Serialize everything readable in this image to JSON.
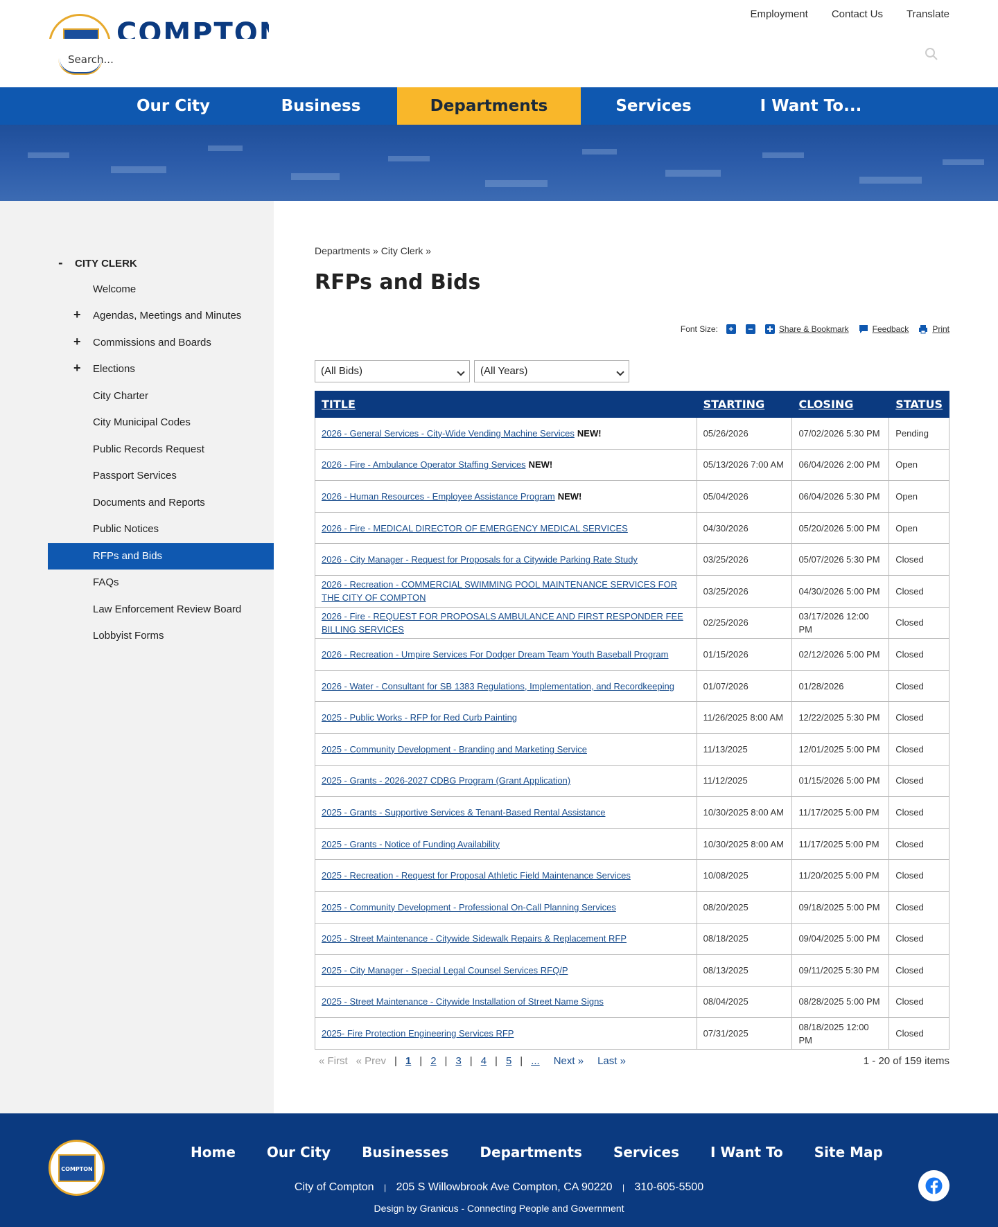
{
  "header": {
    "logo_text": "COMPTON",
    "search_placeholder": "Search...",
    "top_links": [
      "Employment",
      "Contact Us",
      "Translate"
    ]
  },
  "nav": {
    "items": [
      "Our City",
      "Business",
      "Departments",
      "Services",
      "I Want To..."
    ],
    "active": "Departments"
  },
  "sidebar": {
    "group_label": "CITY CLERK",
    "items": [
      {
        "label": "Welcome",
        "expandable": false
      },
      {
        "label": "Agendas, Meetings and Minutes",
        "expandable": true
      },
      {
        "label": "Commissions and Boards",
        "expandable": true
      },
      {
        "label": "Elections",
        "expandable": true
      },
      {
        "label": "City Charter",
        "expandable": false
      },
      {
        "label": "City Municipal Codes",
        "expandable": false
      },
      {
        "label": "Public Records Request",
        "expandable": false
      },
      {
        "label": "Passport Services",
        "expandable": false
      },
      {
        "label": "Documents and Reports",
        "expandable": false
      },
      {
        "label": "Public Notices",
        "expandable": false
      },
      {
        "label": "RFPs and Bids",
        "expandable": false,
        "active": true
      },
      {
        "label": "FAQs",
        "expandable": false
      },
      {
        "label": "Law Enforcement Review Board",
        "expandable": false
      },
      {
        "label": "Lobbyist Forms",
        "expandable": false
      }
    ]
  },
  "main": {
    "breadcrumb": "Departments » City Clerk »",
    "title": "RFPs and Bids",
    "tools": {
      "font_size_label": "Font Size:",
      "increase": "+",
      "decrease": "−",
      "share": "Share & Bookmark",
      "feedback": "Feedback",
      "print": "Print"
    },
    "filters": {
      "bids": "(All Bids)",
      "years": "(All Years)"
    },
    "table": {
      "headers": [
        "TITLE",
        "STARTING",
        "CLOSING",
        "STATUS"
      ],
      "new_badge": "NEW!",
      "rows": [
        {
          "title": "2026 - General Services - City-Wide Vending Machine Services",
          "new": true,
          "starting": "05/26/2026",
          "closing": "07/02/2026 5:30 PM",
          "status": "Pending"
        },
        {
          "title": "2026 - Fire - Ambulance Operator Staffing Services",
          "new": true,
          "starting": "05/13/2026 7:00 AM",
          "closing": "06/04/2026 2:00 PM",
          "status": "Open"
        },
        {
          "title": "2026 - Human Resources - Employee Assistance Program",
          "new": true,
          "starting": "05/04/2026",
          "closing": "06/04/2026 5:30 PM",
          "status": "Open"
        },
        {
          "title": "2026 - Fire - MEDICAL DIRECTOR OF EMERGENCY MEDICAL SERVICES",
          "new": false,
          "starting": "04/30/2026",
          "closing": "05/20/2026 5:00 PM",
          "status": "Open"
        },
        {
          "title": "2026 - City Manager - Request for Proposals for a Citywide Parking Rate Study",
          "new": false,
          "starting": "03/25/2026",
          "closing": "05/07/2026 5:30 PM",
          "status": "Closed"
        },
        {
          "title": "2026 - Recreation - COMMERCIAL SWIMMING POOL MAINTENANCE SERVICES FOR THE CITY OF COMPTON",
          "new": false,
          "starting": "03/25/2026",
          "closing": "04/30/2026 5:00 PM",
          "status": "Closed"
        },
        {
          "title": "2026 - Fire - REQUEST FOR PROPOSALS AMBULANCE AND FIRST RESPONDER FEE BILLING SERVICES",
          "new": false,
          "starting": "02/25/2026",
          "closing": "03/17/2026 12:00 PM",
          "status": "Closed"
        },
        {
          "title": "2026 - Recreation - Umpire Services For Dodger Dream Team Youth Baseball Program",
          "new": false,
          "starting": "01/15/2026",
          "closing": "02/12/2026 5:00 PM",
          "status": "Closed"
        },
        {
          "title": "2026 - Water - Consultant for SB 1383 Regulations, Implementation, and Recordkeeping",
          "new": false,
          "starting": "01/07/2026",
          "closing": "01/28/2026",
          "status": "Closed"
        },
        {
          "title": "2025 - Public Works - RFP for Red Curb Painting",
          "new": false,
          "starting": "11/26/2025 8:00 AM",
          "closing": "12/22/2025 5:30 PM",
          "status": "Closed"
        },
        {
          "title": "2025 - Community Development - Branding and Marketing Service",
          "new": false,
          "starting": "11/13/2025",
          "closing": "12/01/2025 5:00 PM",
          "status": "Closed"
        },
        {
          "title": "2025 - Grants - 2026-2027 CDBG Program (Grant Application)",
          "new": false,
          "starting": "11/12/2025",
          "closing": "01/15/2026 5:00 PM",
          "status": "Closed"
        },
        {
          "title": "2025 - Grants - Supportive Services & Tenant-Based Rental Assistance",
          "new": false,
          "starting": "10/30/2025 8:00 AM",
          "closing": "11/17/2025 5:00 PM",
          "status": "Closed"
        },
        {
          "title": "2025 - Grants - Notice of Funding Availability",
          "new": false,
          "starting": "10/30/2025 8:00 AM",
          "closing": "11/17/2025 5:00 PM",
          "status": "Closed"
        },
        {
          "title": "2025 - Recreation - Request for Proposal Athletic Field Maintenance Services",
          "new": false,
          "starting": "10/08/2025",
          "closing": "11/20/2025 5:00 PM",
          "status": "Closed"
        },
        {
          "title": "2025 - Community Development - Professional On-Call Planning Services",
          "new": false,
          "starting": "08/20/2025",
          "closing": "09/18/2025 5:00 PM",
          "status": "Closed"
        },
        {
          "title": "2025 - Street Maintenance - Citywide Sidewalk Repairs & Replacement RFP",
          "new": false,
          "starting": "08/18/2025",
          "closing": "09/04/2025 5:00 PM",
          "status": "Closed"
        },
        {
          "title": "2025 - City Manager - Special Legal Counsel Services RFQ/P",
          "new": false,
          "starting": "08/13/2025",
          "closing": "09/11/2025 5:30 PM",
          "status": "Closed"
        },
        {
          "title": "2025 - Street Maintenance - Citywide Installation of Street Name Signs",
          "new": false,
          "starting": "08/04/2025",
          "closing": "08/28/2025 5:00 PM",
          "status": "Closed"
        },
        {
          "title": "2025- Fire Protection Engineering Services RFP",
          "new": false,
          "starting": "07/31/2025",
          "closing": "08/18/2025 12:00 PM",
          "status": "Closed"
        }
      ]
    },
    "pager": {
      "first": "« First",
      "prev": "« Prev",
      "pages": [
        "1",
        "2",
        "3",
        "4",
        "5",
        "..."
      ],
      "current": "1",
      "next": "Next »",
      "last": "Last »",
      "count": "1 - 20 of 159 items"
    }
  },
  "footer": {
    "seal_text": "COMPTON",
    "nav": [
      "Home",
      "Our City",
      "Businesses",
      "Departments",
      "Services",
      "I Want To",
      "Site Map"
    ],
    "address_name": "City of Compton",
    "address_street": "205 S Willowbrook Ave Compton, CA 90220",
    "phone": "310-605-5500",
    "credit": "Design by Granicus - Connecting People and Government"
  },
  "colors": {
    "primary": "#0f58b0",
    "navy": "#0b3a80",
    "accent": "#f9b72a"
  }
}
